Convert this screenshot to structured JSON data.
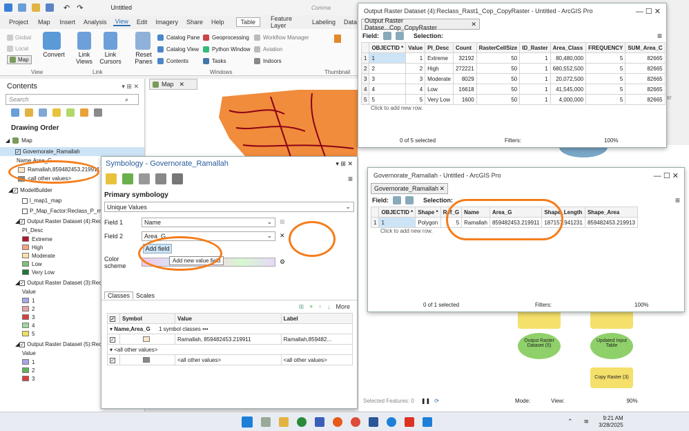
{
  "app": {
    "title": "Untitled",
    "command_search": "Comma"
  },
  "ribbon": {
    "tabs": [
      "Project",
      "Map",
      "Insert",
      "Analysis",
      "View",
      "Edit",
      "Imagery",
      "Share",
      "Help",
      "Table",
      "Feature Layer",
      "Labeling",
      "Data"
    ],
    "view_items": [
      "Global",
      "Local",
      "Map"
    ],
    "convert": "Convert",
    "view_group": "View",
    "link_views": "Link Views",
    "link_cursors": "Link Cursors",
    "link_group": "Link",
    "reset_panes": "Reset Panes",
    "windows": [
      "Catalog Pane",
      "Catalog View",
      "Contents",
      "Geoprocessing",
      "Python Window",
      "Tasks",
      "Workflow Manager",
      "Aviation",
      "Indoors"
    ],
    "windows_group": "Windows",
    "thumbnail_group": "Thumbnail"
  },
  "contents": {
    "title": "Contents",
    "search_placeholder": "Search",
    "drawing_order": "Drawing Order",
    "map_tab": "Map",
    "items": {
      "map": "Map",
      "gov": "Governorate_Ramallah",
      "gov_field": "Name,Area_G",
      "gov_value": "Ramallah,859482453.219911",
      "other": "<all other values>",
      "modelbuilder": "ModelBuilder",
      "lmap": "l_map1_map",
      "pmap": "P_Map_Factor:Reclass_P_ma3",
      "or4": "Output Raster Dataset (4):Recl",
      "pi_desc": "PI_Desc",
      "or3": "Output Raster Dataset (3):Recl",
      "or5": "Output Raster Dataset (5):Recl",
      "value": "Value"
    },
    "pi_legend": [
      {
        "label": "Extreme",
        "color": "#b2182b"
      },
      {
        "label": "High",
        "color": "#f4a582"
      },
      {
        "label": "Moderate",
        "color": "#fde0a8"
      },
      {
        "label": "Low",
        "color": "#7fbf7b"
      },
      {
        "label": "Very Low",
        "color": "#1b7837"
      }
    ],
    "value_legend": [
      {
        "label": "1",
        "color": "#a6a6e8"
      },
      {
        "label": "2",
        "color": "#e8a0a0"
      },
      {
        "label": "3",
        "color": "#d84040"
      },
      {
        "label": "4",
        "color": "#a0d8a0"
      },
      {
        "label": "5",
        "color": "#f0e060"
      }
    ],
    "value_legend2": [
      {
        "label": "1",
        "color": "#a6a6e8"
      },
      {
        "label": "2",
        "color": "#5cb85c"
      },
      {
        "label": "3",
        "color": "#d84040"
      }
    ]
  },
  "symbology": {
    "title": "Symbology - Governorate_Ramallah",
    "primary": "Primary symbology",
    "method": "Unique Values",
    "field1_label": "Field 1",
    "field1": "Name",
    "field2_label": "Field 2",
    "field2": "Area_G",
    "add_field": "Add field",
    "color_scheme": "Color scheme",
    "tooltip": "Add new value field",
    "tabs": [
      "Classes",
      "Scales"
    ],
    "more": "More",
    "cols": [
      "Symbol",
      "Value",
      "Label"
    ],
    "group": "Name,Area_G",
    "count": "1 symbol classes",
    "row_value": "Ramallah, 859482453.219911",
    "row_label": "Ramallah,859482...",
    "other_head": "<all other values>",
    "other_value": "<all other values>",
    "other_label": "<all other values>"
  },
  "raster_table": {
    "window_title": "Output Raster Dataset (4):Reclass_Rast1_Cop_CopyRaster - Untitled - ArcGIS Pro",
    "tab": "Output Raster Datase...Cop_CopyRaster",
    "field": "Field:",
    "selection": "Selection:",
    "cols": [
      "OBJECTID *",
      "Value",
      "PI_Desc",
      "Count",
      "RasterCellSize",
      "ID_Raster",
      "Area_Class",
      "FREQUENCY",
      "SUM_Area_C"
    ],
    "rows": [
      [
        "1",
        "1",
        "Extreme",
        "32192",
        "50",
        "1",
        "80,480,000",
        "5",
        "82665"
      ],
      [
        "2",
        "2",
        "High",
        "272221",
        "50",
        "1",
        "680,552,500",
        "5",
        "82665"
      ],
      [
        "3",
        "3",
        "Moderate",
        "8029",
        "50",
        "1",
        "20,072,500",
        "5",
        "82665"
      ],
      [
        "4",
        "4",
        "Low",
        "16618",
        "50",
        "1",
        "41,545,000",
        "5",
        "82665"
      ],
      [
        "5",
        "5",
        "Very Low",
        "1600",
        "50",
        "1",
        "4,000,000",
        "5",
        "82665"
      ]
    ],
    "add_row": "Click to add new row.",
    "status": "0 of 5 selected",
    "filters": "Filters:",
    "zoom": "100%"
  },
  "gov_table": {
    "window_title": "Governorate_Ramallah - Untitled - ArcGIS Pro",
    "tab": "Governorate_Ramallah",
    "field": "Field:",
    "selection": "Selection:",
    "cols": [
      "OBJECTID *",
      "Shape *",
      "Ref_G",
      "Name",
      "Area_G",
      "Shape_Length",
      "Shape_Area"
    ],
    "rows": [
      [
        "1",
        "Polygon",
        "5",
        "Ramallah",
        "859482453.219911",
        "187157.941231",
        "859482453.219913"
      ]
    ],
    "add_row": "Click to add new row.",
    "status": "0 of 1 selected",
    "filters": "Filters:",
    "zoom": "100%"
  },
  "model": {
    "node1": "Output Raster Dataset (5)",
    "node2": "Updated Input Table",
    "node3": "Copy Raster (3)",
    "selected_features": "Selected Features: 0",
    "mode": "Mode:",
    "view": "View:",
    "zoom": "90%",
    "bar": "bar"
  },
  "taskbar": {
    "time": "9:21 AM",
    "date": "3/28/2025"
  }
}
